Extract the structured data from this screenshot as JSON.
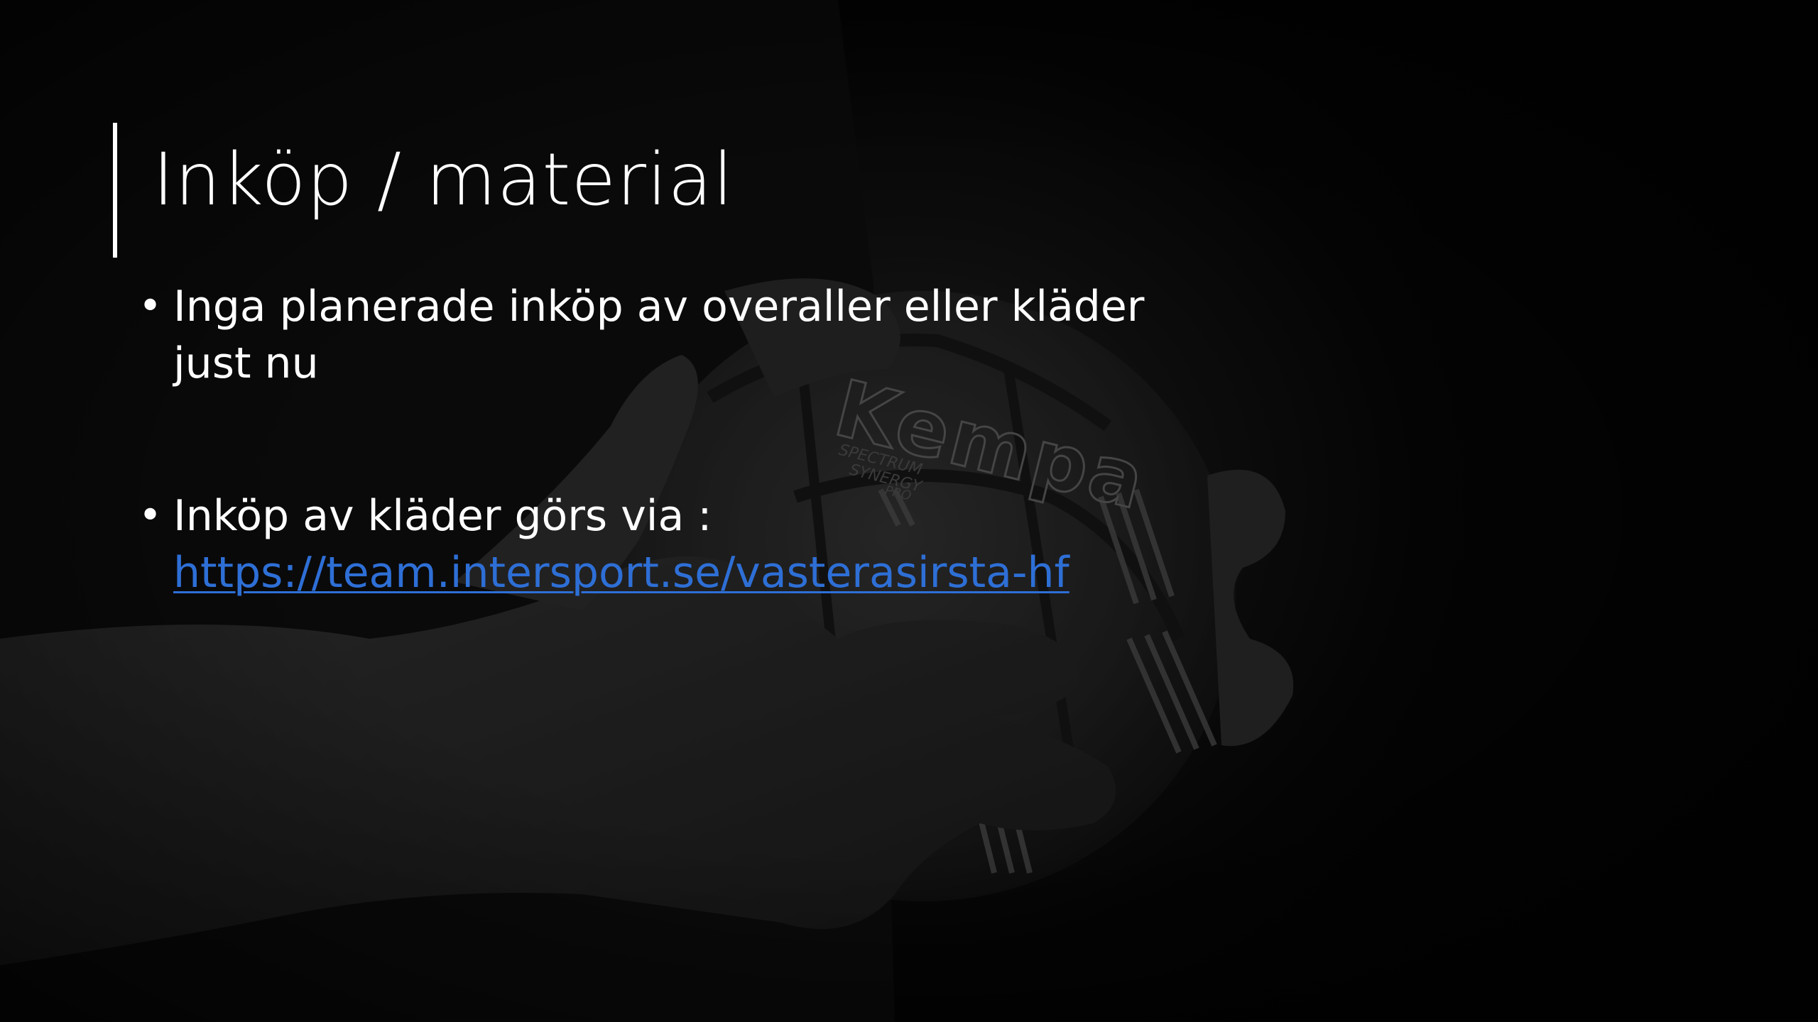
{
  "slide": {
    "title": "Inköp / material",
    "bullets": [
      {
        "text": "Inga planerade inköp av overaller eller kläder just nu"
      },
      {
        "text": "Inköp av kläder görs via :",
        "link": "https://team.intersport.se/vasterasirsta-hf"
      }
    ],
    "background": {
      "ball_brand": "Kempa",
      "ball_model_lines": [
        "SPECTRUM",
        "SYNERGY",
        "PRO"
      ]
    },
    "colors": {
      "text": "#ffffff",
      "link": "#2e6fd6",
      "background": "#0a0a0a"
    }
  }
}
